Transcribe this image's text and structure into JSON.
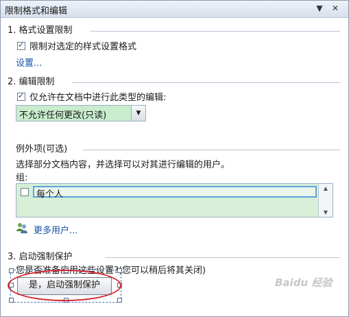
{
  "pane": {
    "title": "限制格式和编辑",
    "dropdown_glyph": "▼",
    "close_glyph": "✕"
  },
  "section1": {
    "heading": "1. 格式设置限制",
    "checkbox_label": "限制对选定的样式设置格式",
    "checkbox_checked": true,
    "settings_link": "设置..."
  },
  "section2": {
    "heading": "2. 编辑限制",
    "checkbox_label": "仅允许在文档中进行此类型的编辑:",
    "checkbox_checked": true,
    "select_value": "不允许任何更改(只读)",
    "exceptions_heading": "例外项(可选)",
    "exceptions_desc": "选择部分文档内容，并选择可以对其进行编辑的用户。",
    "group_label": "组:",
    "group_items": [
      "每个人"
    ],
    "more_users_link": "更多用户..."
  },
  "section3": {
    "heading": "3. 启动强制保护",
    "question": "您是否准备应用这些设置?(您可以稍后将其关闭)",
    "start_button": "是，启动强制保护"
  },
  "watermark": "Baidu 经验",
  "colors": {
    "select_bg": "#c8eccc",
    "list_bg": "#d6efd6",
    "link": "#1452a8",
    "highlight_ellipse": "#d8202a"
  }
}
